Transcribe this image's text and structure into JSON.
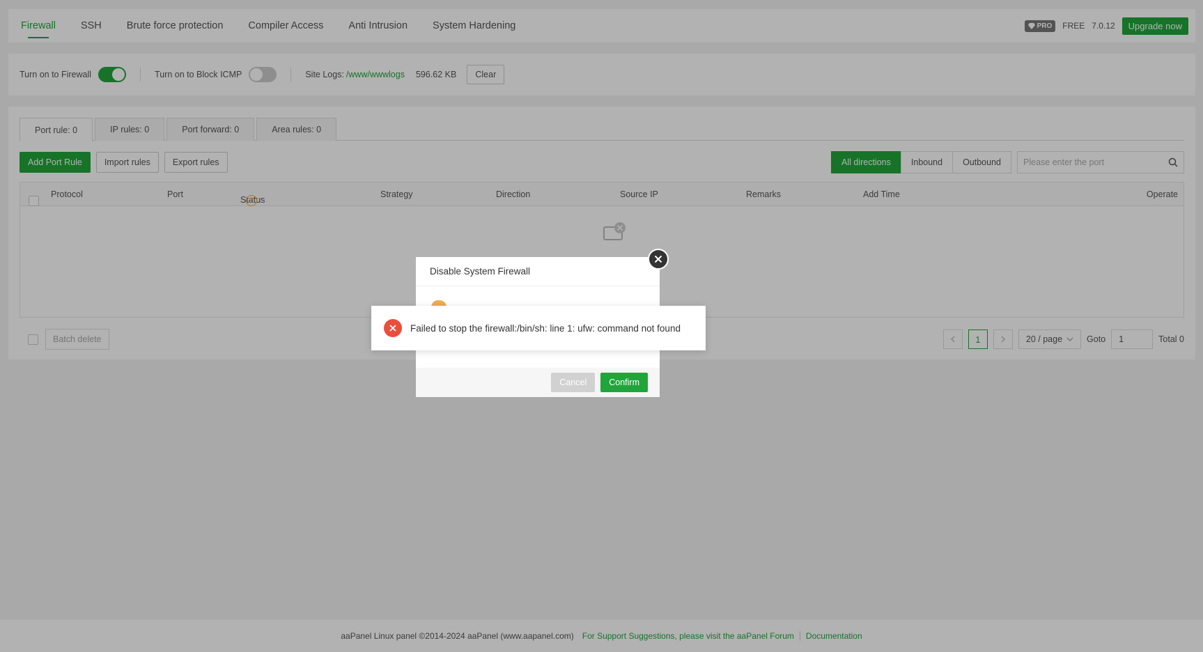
{
  "topnav": {
    "tabs": [
      {
        "label": "Firewall",
        "active": true
      },
      {
        "label": "SSH",
        "active": false
      },
      {
        "label": "Brute force protection",
        "active": false
      },
      {
        "label": "Compiler Access",
        "active": false
      },
      {
        "label": "Anti Intrusion",
        "active": false
      },
      {
        "label": "System Hardening",
        "active": false
      }
    ],
    "pro_badge": "PRO",
    "free_label": "FREE",
    "version": "7.0.12",
    "upgrade_label": "Upgrade now"
  },
  "toolbar": {
    "firewall_toggle_label": "Turn on to Firewall",
    "firewall_on": true,
    "icmp_toggle_label": "Turn on to Block ICMP",
    "icmp_on": false,
    "site_logs_label": "Site Logs:",
    "site_logs_path": "/www/wwwlogs",
    "log_size": "596.62 KB",
    "clear_label": "Clear"
  },
  "subtabs": [
    {
      "label": "Port rule: 0",
      "active": true
    },
    {
      "label": "IP rules: 0",
      "active": false
    },
    {
      "label": "Port forward: 0",
      "active": false
    },
    {
      "label": "Area rules: 0",
      "active": false
    }
  ],
  "actions": {
    "add_label": "Add Port Rule",
    "import_label": "Import rules",
    "export_label": "Export rules",
    "directions": [
      "All directions",
      "Inbound",
      "Outbound"
    ],
    "active_direction": "All directions",
    "search_placeholder": "Please enter the port"
  },
  "table": {
    "columns": [
      "Protocol",
      "Port",
      "Status",
      "Strategy",
      "Direction",
      "Source IP",
      "Remarks",
      "Add Time",
      "Operate"
    ],
    "help_glyph": "?"
  },
  "pagination": {
    "batch_delete_label": "Batch delete",
    "current_page": "1",
    "page_size": "20 / page",
    "goto_label": "Goto",
    "goto_value": "1",
    "total_label": "Total 0"
  },
  "footer": {
    "copyright": "aaPanel Linux panel ©2014-2024 aaPanel (www.aapanel.com)",
    "support_link": "For Support Suggestions, please visit the aaPanel Forum",
    "docs_link": "Documentation"
  },
  "dialog": {
    "title": "Disable System Firewall",
    "cancel_label": "Cancel",
    "confirm_label": "Confirm"
  },
  "toast": {
    "message": "Failed to stop the firewall:/bin/sh: line 1: ufw: command not found"
  },
  "colors": {
    "accent": "#20a53a",
    "error": "#ea4e3d",
    "warning": "#f0ad4e"
  }
}
